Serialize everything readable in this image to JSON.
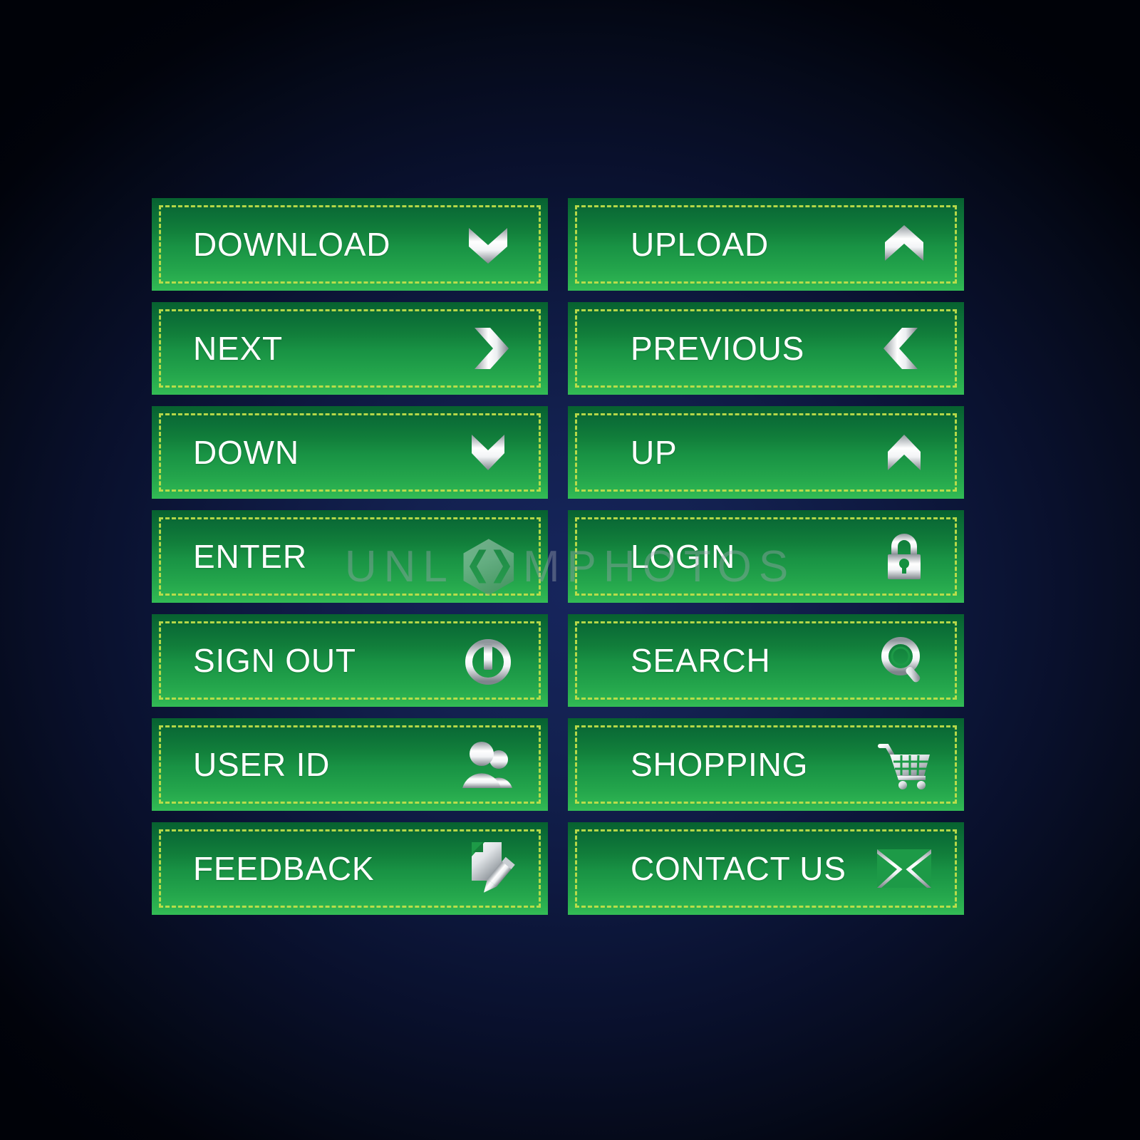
{
  "background": {
    "glow_color": "#16255c",
    "edge_color": "#000208"
  },
  "theme": {
    "button_green_top": "#0a7a3c",
    "button_green_bottom": "#33bc55",
    "stitch_color": "#c4e04a",
    "label_color": "#ffffff",
    "icon_silver_light": "#ffffff",
    "icon_silver_dark": "#8d9399"
  },
  "watermark": {
    "text_left": "UNL",
    "text_right": "MPHOTOS",
    "logo_icon": "hexagon-brackets-icon",
    "full_text": "UNLIMPHOTOS"
  },
  "buttons": {
    "columns": [
      {
        "name": "left-column",
        "items": [
          {
            "label": "DOWNLOAD",
            "icon": "chevron-double-down-icon"
          },
          {
            "label": "NEXT",
            "icon": "chevron-right-icon"
          },
          {
            "label": "DOWN",
            "icon": "chevron-down-icon"
          },
          {
            "label": "ENTER",
            "icon": "none-icon"
          },
          {
            "label": "SIGN OUT",
            "icon": "power-icon"
          },
          {
            "label": "USER ID",
            "icon": "users-icon"
          },
          {
            "label": "FEEDBACK",
            "icon": "document-pencil-icon"
          }
        ]
      },
      {
        "name": "right-column",
        "items": [
          {
            "label": "UPLOAD",
            "icon": "chevron-double-up-icon"
          },
          {
            "label": "PREVIOUS",
            "icon": "chevron-left-icon"
          },
          {
            "label": "UP",
            "icon": "chevron-up-icon"
          },
          {
            "label": "LOGIN",
            "icon": "lock-icon"
          },
          {
            "label": "SEARCH",
            "icon": "magnifier-icon"
          },
          {
            "label": "SHOPPING",
            "icon": "shopping-cart-icon"
          },
          {
            "label": "CONTACT US",
            "icon": "envelope-icon"
          }
        ]
      }
    ]
  }
}
